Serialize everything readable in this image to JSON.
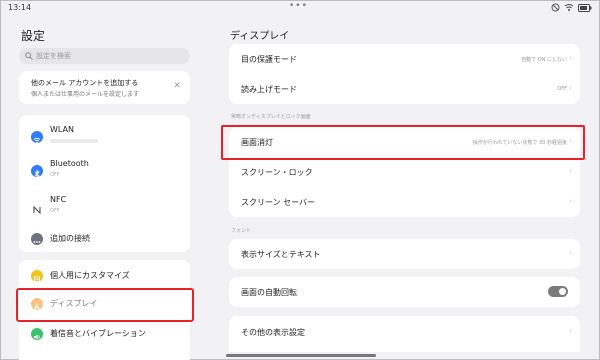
{
  "status": {
    "time": "13:14",
    "dots": "•••"
  },
  "sidebar": {
    "title": "設定",
    "search_placeholder": "設定を検索",
    "mail_card": {
      "title": "他のメール アカウントを追加する",
      "subtitle": "個人または仕事用のメールを設定します"
    },
    "network": [
      {
        "label": "WLAN",
        "sub": "",
        "icon": "wifi-icon",
        "color": "#2f7cf6"
      },
      {
        "label": "Bluetooth",
        "sub": "OFF",
        "icon": "bluetooth-icon",
        "color": "#2f7cf6"
      },
      {
        "label": "NFC",
        "sub": "OFF",
        "icon": "nfc-icon",
        "color": "#ffffff"
      },
      {
        "label": "追加の接続",
        "sub": "",
        "icon": "more-connections-icon",
        "color": "#6b7280"
      }
    ],
    "personal": [
      {
        "label": "個人用にカスタマイズ",
        "icon": "palette-icon",
        "color": "#f4c21b"
      },
      {
        "label": "ディスプレイ",
        "icon": "display-icon",
        "color": "#f59a2b"
      },
      {
        "label": "着信音とバイブレーション",
        "icon": "sound-icon",
        "color": "#3ac16c"
      }
    ]
  },
  "main": {
    "title": "ディスプレイ",
    "group1": [
      {
        "label": "目の保護モード",
        "value": "自動で ON にしない"
      },
      {
        "label": "読み上げモード",
        "value": "OFF"
      }
    ],
    "section_lock": "常時オンディスプレイとロック画面",
    "group2": [
      {
        "label": "画面消灯",
        "value": "操作が行われていない状態で 30 秒経過後"
      },
      {
        "label": "スクリーン・ロック",
        "value": ""
      },
      {
        "label": "スクリーン セーバー",
        "value": ""
      }
    ],
    "section_font": "フォント",
    "font_size": "表示サイズとテキスト",
    "auto_rotate": {
      "label": "画面の自動回転",
      "enabled": false
    },
    "other_display": "その他の表示設定"
  },
  "colors": {
    "highlight": "#e8222b",
    "accent": "#2f7cf6"
  }
}
